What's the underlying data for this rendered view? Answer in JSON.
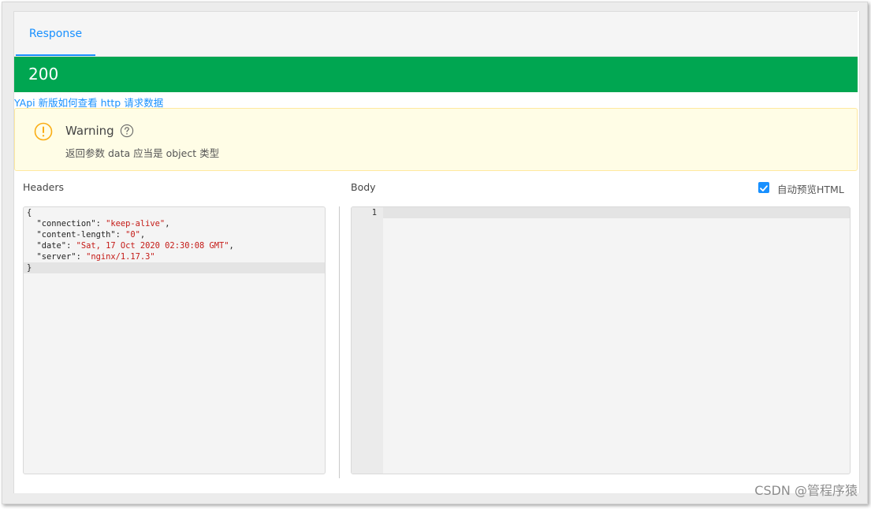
{
  "tabs": [
    {
      "label": "Response",
      "active": true
    }
  ],
  "status": {
    "code": "200",
    "color": "#00a651"
  },
  "help_link": {
    "text": "YApi 新版如何查看 http 请求数据"
  },
  "warning": {
    "title": "Warning",
    "message": "返回参数 data 应当是 object 类型",
    "icon": "exclamation-circle-icon",
    "help_icon": "question-circle-icon",
    "color": "#faad14"
  },
  "headers_panel": {
    "label": "Headers",
    "open_brace": "{",
    "close_brace": "}",
    "entries": [
      {
        "key": "\"connection\"",
        "sep": ": ",
        "value": "\"keep-alive\"",
        "trail": ","
      },
      {
        "key": "\"content-length\"",
        "sep": ": ",
        "value": "\"0\"",
        "trail": ","
      },
      {
        "key": "\"date\"",
        "sep": ": ",
        "value": "\"Sat, 17 Oct 2020 02:30:08 GMT\"",
        "trail": ","
      },
      {
        "key": "\"server\"",
        "sep": ": ",
        "value": "\"nginx/1.17.3\"",
        "trail": ""
      }
    ]
  },
  "body_panel": {
    "label": "Body",
    "line_number": "1",
    "auto_preview": {
      "label": "自动预览HTML",
      "checked": true
    }
  },
  "watermark": "CSDN @管程序猿",
  "colors": {
    "accent": "#1890ff",
    "string": "#c41a16"
  }
}
